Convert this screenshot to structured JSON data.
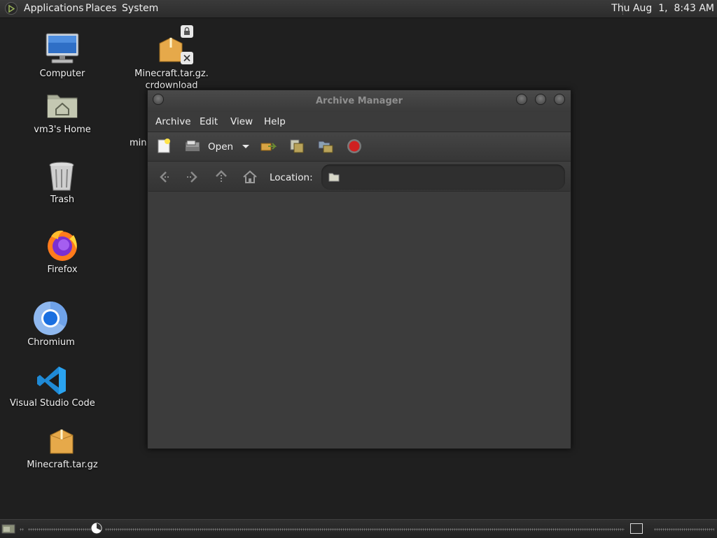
{
  "top_panel": {
    "menus": [
      "Applications",
      "Places",
      "System"
    ],
    "clock": "Thu Aug  1,  8:43 AM"
  },
  "desktop": {
    "icons": [
      {
        "label": "Computer",
        "icon": "computer-icon"
      },
      {
        "label": "vm3's Home",
        "icon": "home-folder-icon"
      },
      {
        "label": "Trash",
        "icon": "trash-icon"
      },
      {
        "label": "Firefox",
        "icon": "firefox-icon"
      },
      {
        "label": "Chromium",
        "icon": "chromium-icon"
      },
      {
        "label": "Visual Studio Code",
        "icon": "vscode-icon"
      },
      {
        "label": "Minecraft.tar.gz",
        "icon": "archive-icon"
      }
    ],
    "download_icon": {
      "label_line1": "Minecraft.tar.gz.",
      "label_line2": "crdownload",
      "icon": "archive-partial-icon"
    },
    "partial_label": "min"
  },
  "window": {
    "title": "Archive Manager",
    "menu": [
      "Archive",
      "Edit",
      "View",
      "Help"
    ],
    "toolbar": {
      "open_label": "Open",
      "buttons": [
        "new-archive-icon",
        "open-archive-icon",
        "dropdown-arrow-icon",
        "extract-icon",
        "add-files-icon",
        "add-folder-icon",
        "stop-icon"
      ]
    },
    "location": {
      "label": "Location:",
      "value": ""
    }
  },
  "colors": {
    "desktop": "#1f1f1f",
    "panel": "#2f2f2f",
    "window": "#3a3a3a",
    "accent_stop": "#d02020"
  }
}
